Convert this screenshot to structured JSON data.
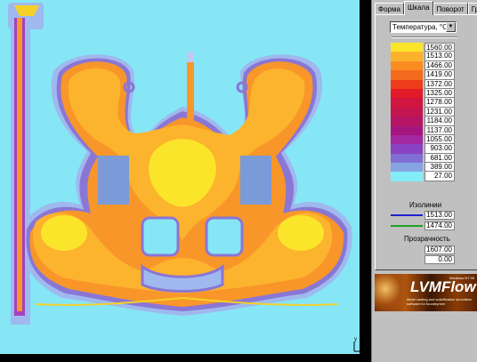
{
  "tabs": [
    "Форма",
    "Шкала",
    "Поворот",
    "Гр"
  ],
  "active_tab": "Шкала",
  "parameter_select": {
    "value": "Температура, °С"
  },
  "scale": [
    {
      "value": "1560.00",
      "color": "#fbe52a"
    },
    {
      "value": "1513.00",
      "color": "#fcb12d"
    },
    {
      "value": "1466.00",
      "color": "#fb8c22"
    },
    {
      "value": "1419.00",
      "color": "#f56a1d"
    },
    {
      "value": "1372.00",
      "color": "#ee3d1b"
    },
    {
      "value": "1325.00",
      "color": "#e11b27"
    },
    {
      "value": "1278.00",
      "color": "#d0153f"
    },
    {
      "value": "1231.00",
      "color": "#c3154f"
    },
    {
      "value": "1184.00",
      "color": "#b61566"
    },
    {
      "value": "1137.00",
      "color": "#a5157f"
    },
    {
      "value": "1055.00",
      "color": "#a128a0"
    },
    {
      "value": "903.00",
      "color": "#8a42c4"
    },
    {
      "value": "681.00",
      "color": "#7f6fd4"
    },
    {
      "value": "389.00",
      "color": "#87a4e2"
    },
    {
      "value": "27.00",
      "color": "#84ecf7"
    }
  ],
  "isolines": {
    "label": "Изолинии",
    "items": [
      {
        "value": "1513.00",
        "color": "#2020d0"
      },
      {
        "value": "1474.00",
        "color": "#20a020"
      }
    ]
  },
  "porosity": {
    "label": "Прозрачность",
    "values": [
      "1607.00",
      "0.00"
    ]
  },
  "logo": {
    "title": "LVMFlow",
    "version": "Windows NT 95",
    "tagline": "Metal casting and solidification simulation software for foundrymen"
  },
  "axes": {
    "y_label": "y",
    "x_label": "x"
  }
}
